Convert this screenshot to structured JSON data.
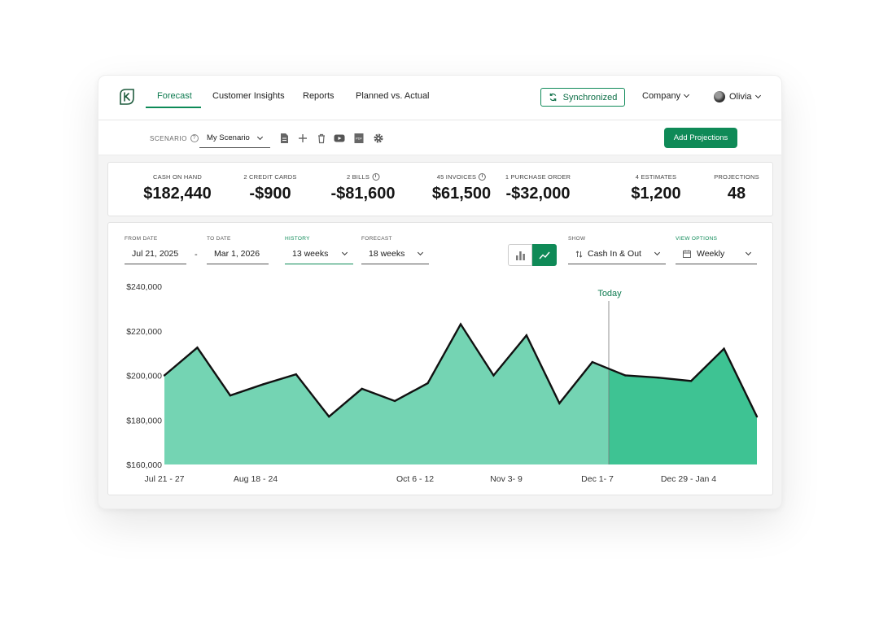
{
  "nav": {
    "tabs": [
      "Forecast",
      "Customer Insights",
      "Reports",
      "Planned vs. Actual"
    ],
    "sync_label": "Synchronized",
    "company_label": "Company",
    "user_label": "Olivia"
  },
  "scenario": {
    "label": "SCENARIO",
    "value": "My Scenario",
    "add_projections_label": "Add Projections"
  },
  "summary": [
    {
      "label": "CASH ON HAND",
      "value": "$182,440",
      "info": false
    },
    {
      "label": "2 CREDIT CARDS",
      "value": "-$900",
      "info": false
    },
    {
      "label": "2 BILLS",
      "value": "-$81,600",
      "info": true
    },
    {
      "label": "45 INVOICES",
      "value": "$61,500",
      "info": true
    },
    {
      "label": "1 PURCHASE ORDER",
      "value": "-$32,000",
      "info": false
    },
    {
      "label": "4 ESTIMATES",
      "value": "$1,200",
      "info": false
    },
    {
      "label": "PROJECTIONS",
      "value": "48",
      "info": false
    }
  ],
  "filters": {
    "from_label": "FROM DATE",
    "from_value": "Jul 21, 2025",
    "to_label": "TO DATE",
    "to_value": "Mar 1, 2026",
    "history_label": "HISTORY",
    "history_value": "13 weeks",
    "forecast_label": "FORECAST",
    "forecast_value": "18 weeks",
    "show_label": "SHOW",
    "show_value": "Cash In & Out",
    "view_label": "VIEW OPTIONS",
    "view_value": "Weekly",
    "range_separator": "-"
  },
  "colors": {
    "brand": "#0f8a57",
    "history_fill": "#74d4b3",
    "forecast_fill": "#3ec393"
  },
  "chart_data": {
    "type": "area",
    "title": "",
    "xlabel": "",
    "ylabel": "",
    "ylim": [
      160000,
      240000
    ],
    "yticks": [
      160000,
      180000,
      200000,
      220000,
      240000
    ],
    "ytick_labels": [
      "$160,000",
      "$180,000",
      "$200,000",
      "$220,000",
      "$240,000"
    ],
    "xtick_labels": [
      "Jul 21 - 27",
      "Aug 18 - 24",
      "Oct 6 - 12",
      "Nov 3- 9",
      "Dec 1- 7",
      "Dec 29 - Jan 4"
    ],
    "xtick_index": [
      0,
      4,
      11,
      15,
      19,
      23
    ],
    "today_label": "Today",
    "today_index": 13.5,
    "series": [
      {
        "values": [
          200000,
          212500,
          191000,
          196000,
          200500,
          181500,
          194000,
          188500,
          196500,
          223000,
          200000,
          218000,
          187500,
          206000,
          200000,
          199000,
          197500,
          212000,
          181500
        ]
      }
    ]
  }
}
